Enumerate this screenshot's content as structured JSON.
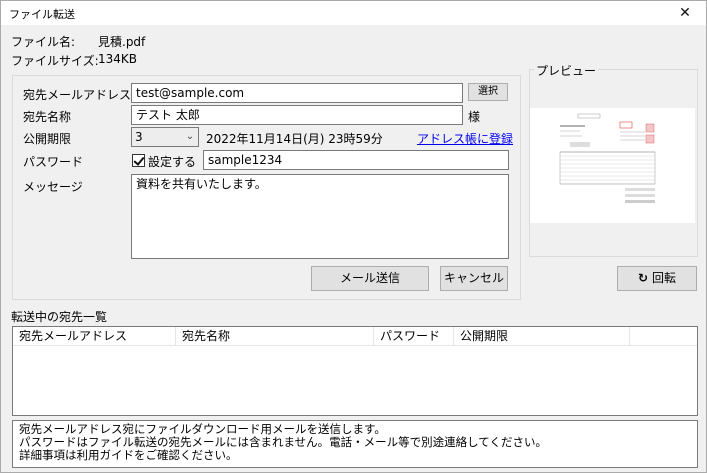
{
  "window": {
    "title": "ファイル転送",
    "close": "✕"
  },
  "file": {
    "name_label": "ファイル名:",
    "name_value": "見積.pdf",
    "size_label": "ファイルサイズ:",
    "size_value": "134KB"
  },
  "form": {
    "email_label": "宛先メールアドレス",
    "email_value": "test@sample.com",
    "select_button": "選択",
    "name_label": "宛先名称",
    "name_value": "テスト 太郎",
    "honorific": "様",
    "period_label": "公開期限",
    "period_value": "3",
    "period_date": "2022年11月14日(月) 23時59分",
    "address_book_link": "アドレス帳に登録",
    "password_label": "パスワード",
    "password_checkbox_label": "設定する",
    "password_checked": true,
    "password_value": "sample1234",
    "message_label": "メッセージ",
    "message_value": "資料を共有いたします。",
    "send_button": "メール送信",
    "cancel_button": "キャンセル"
  },
  "preview": {
    "label": "プレビュー",
    "rotate_button": "回転"
  },
  "list": {
    "title": "転送中の宛先一覧",
    "columns": [
      "宛先メールアドレス",
      "宛先名称",
      "パスワード",
      "公開期限"
    ]
  },
  "info": {
    "line1": "宛先メールアドレス宛にファイルダウンロード用メールを送信します。",
    "line2": "パスワードはファイル転送の宛先メールには含まれません。電話・メール等で別途連絡してください。",
    "line3": "詳細事項は利用ガイドをご確認ください。"
  }
}
